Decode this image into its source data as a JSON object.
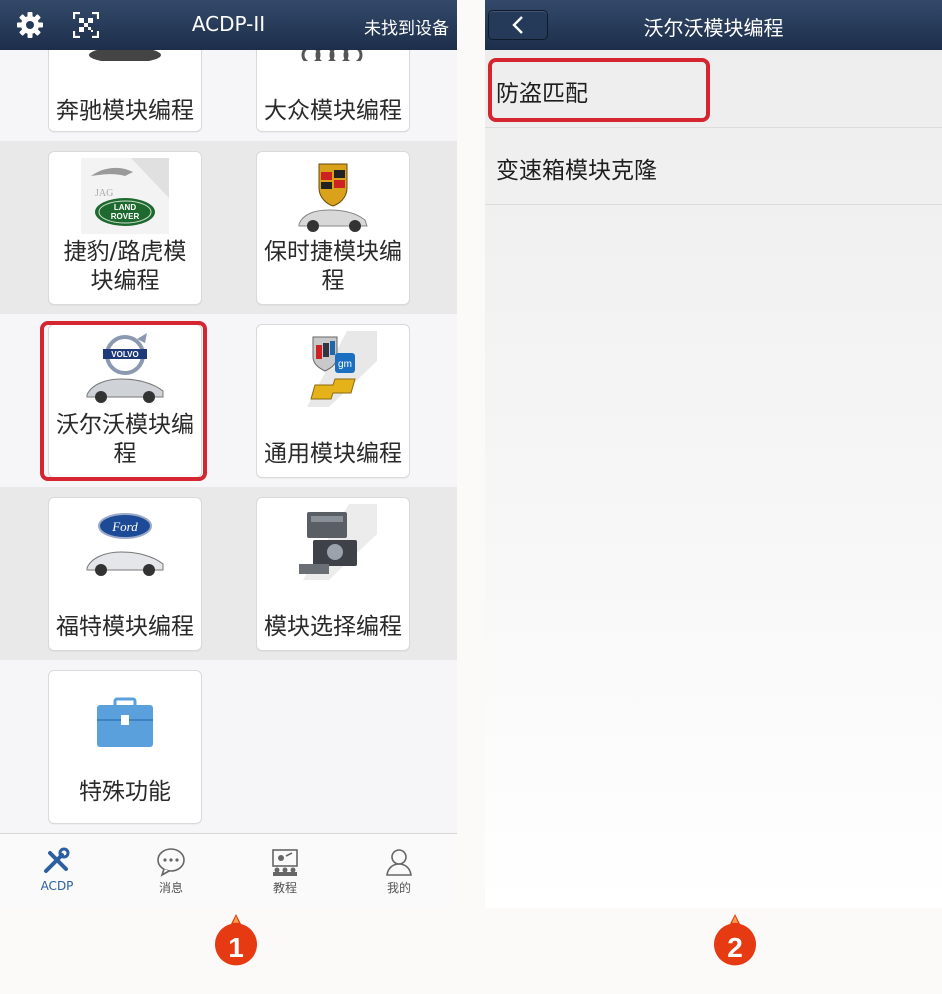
{
  "screen1": {
    "app_title": "ACDP-II",
    "device_status": "未找到设备",
    "cards": [
      {
        "label": "奔驰模块编程",
        "icon": "mercedes-logo-icon"
      },
      {
        "label": "大众模块编程",
        "icon": "audi-logo-icon"
      },
      {
        "label": "捷豹/路虎模块编程",
        "icon": "jaguar-landrover-logo-icon"
      },
      {
        "label": "保时捷模块编程",
        "icon": "porsche-logo-icon"
      },
      {
        "label": "沃尔沃模块编程",
        "icon": "volvo-logo-icon",
        "highlighted": true
      },
      {
        "label": "通用模块编程",
        "icon": "gm-logo-icon"
      },
      {
        "label": "福特模块编程",
        "icon": "ford-logo-icon"
      },
      {
        "label": "模块选择编程",
        "icon": "ecu-module-icon"
      },
      {
        "label": "特殊功能",
        "icon": "toolbox-icon"
      }
    ],
    "tabs": [
      {
        "label": "ACDP",
        "icon": "tools-icon",
        "active": true
      },
      {
        "label": "消息",
        "icon": "chat-icon"
      },
      {
        "label": "教程",
        "icon": "tutorial-icon"
      },
      {
        "label": "我的",
        "icon": "person-icon"
      }
    ]
  },
  "screen2": {
    "title": "沃尔沃模块编程",
    "items": [
      {
        "label": "防盗匹配",
        "highlighted": true
      },
      {
        "label": "变速箱模块克隆"
      }
    ]
  },
  "steps": [
    "1",
    "2"
  ],
  "colors": {
    "header": "#243a5a",
    "highlight": "#d42531",
    "badge": "#e53a12",
    "active_tab": "#2b5fa0"
  }
}
